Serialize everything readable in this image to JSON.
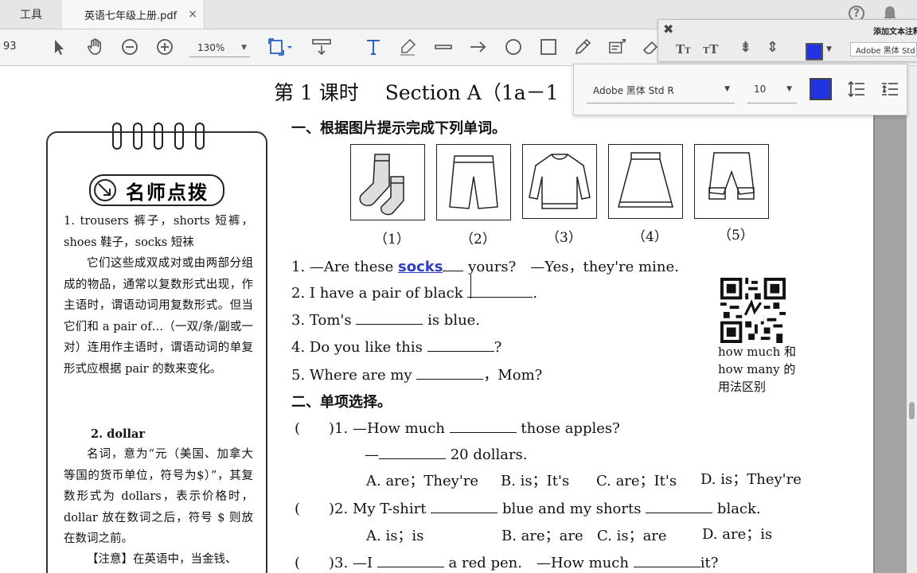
{
  "tabs": {
    "tools": "工具",
    "doc_name": "英语七年级上册.pdf",
    "close": "×"
  },
  "toolbar": {
    "page_number": "93",
    "zoom": "130%"
  },
  "text_panel": {
    "title": "添加文本注释",
    "font": "Adobe 黑体 Std R"
  },
  "text_props": {
    "font": "Adobe 黑体 Std R",
    "size": "10",
    "color": "#2233e0"
  },
  "document": {
    "lesson_title": "第 1 课时　 Section A（1a－1",
    "tip": {
      "header": "名师点拨",
      "p1": "1. trousers 裤子，shorts 短裤，shoes 鞋子，socks 短袜",
      "p2": "它们这些成双成对或由两部分组成的物品，通常以复数形式出现，作主语时，谓语动词用复数形式。但当它们和 a pair of…（一双/条/副或一对）连用作主语时，谓语动词的单复形式应根据 pair 的数来变化。",
      "p3": "2. dollar",
      "p4": "名词，意为“元（美国、加拿大等国的货币单位，符号为$）”，其复数形式为 dollars，表示价格时，dollar 放在数词之后，符号 $ 则放在数词之前。",
      "p5": "【注意】在英语中，当金钱、"
    },
    "section1": {
      "title": "一、根据图片提示完成下列单词。",
      "images": [
        "（1）",
        "（2）",
        "（3）",
        "（4）",
        "（5）"
      ],
      "q1a": "1. —Are these",
      "q1_answer": "socks",
      "q1b": "yours?　—Yes，they're mine.",
      "q2": "2. I have a pair of black",
      "q3a": "3. Tom's",
      "q3b": "is blue.",
      "q4a": "4. Do you like this",
      "q4b": "?",
      "q5a": "5. Where are my",
      "q5b": "，Mom?"
    },
    "qr_caption": "how much 和 how many 的用法区别",
    "section2": {
      "title": "二、单项选择。",
      "q1a": "(　　)1. —How much",
      "q1b": "those apples?",
      "q1c": "—",
      "q1d": "20 dollars.",
      "q1_opts": [
        "A. are；They're",
        "B. is；It's",
        "C. are；It's",
        "D. is；They're"
      ],
      "q2a": "(　　)2. My T-shirt",
      "q2b": "blue and my shorts",
      "q2c": "black.",
      "q2_opts": [
        "A. is；is",
        "B. are；are",
        "C. is；are",
        "D. are；is"
      ],
      "q3a": "(　　)3. —I",
      "q3b": "a red pen.　—How much",
      "q3c": "it?"
    }
  }
}
